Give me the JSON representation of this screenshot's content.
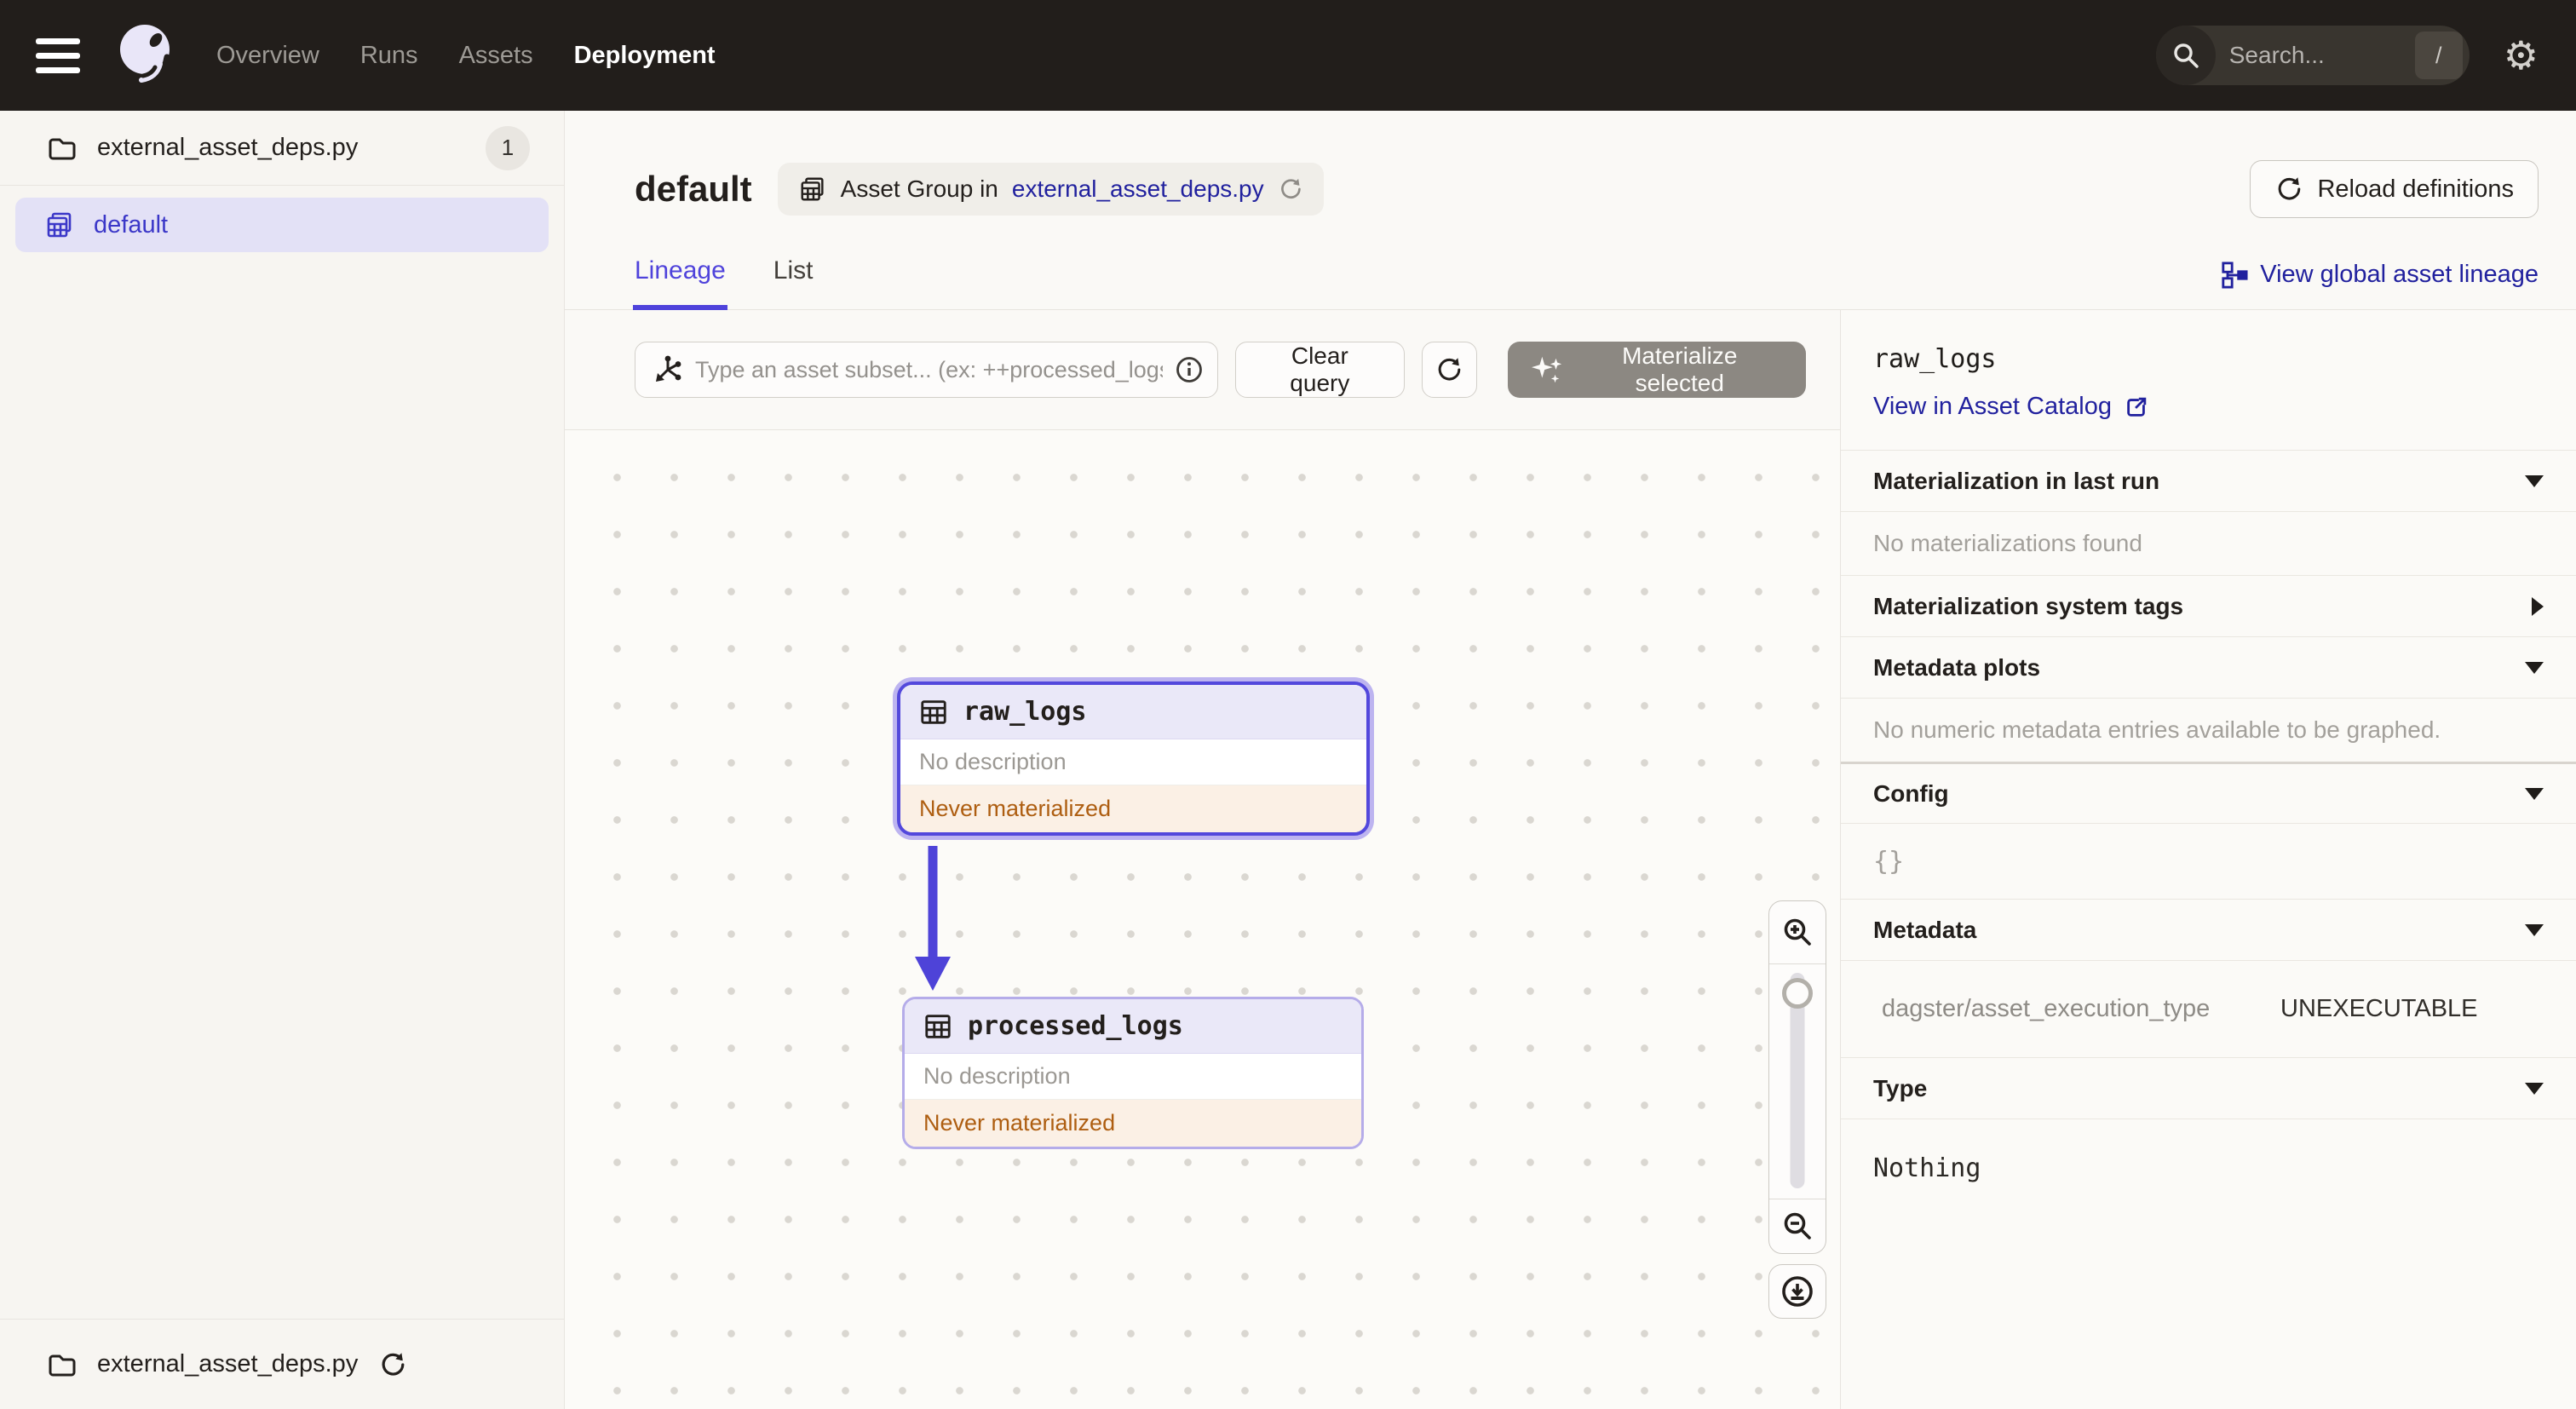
{
  "colors": {
    "accent": "#4F43DB",
    "link_navy": "#21219E",
    "status_warning_text": "#AE5E11",
    "status_warning_bg": "#FBF0E5",
    "nav_bg": "#221E1B"
  },
  "nav": {
    "items": [
      {
        "label": "Overview"
      },
      {
        "label": "Runs"
      },
      {
        "label": "Assets"
      },
      {
        "label": "Deployment"
      }
    ],
    "search": {
      "placeholder": "Search...",
      "shortcut": "/"
    }
  },
  "sidebar": {
    "file": {
      "label": "external_asset_deps.py",
      "count": "1"
    },
    "selected_group": {
      "label": "default"
    },
    "footer": {
      "label": "external_asset_deps.py"
    }
  },
  "header": {
    "title": "default",
    "group_tag": {
      "prefix": "Asset Group in",
      "link_label": "external_asset_deps.py"
    },
    "reload_button_label": "Reload definitions"
  },
  "tabs": [
    {
      "label": "Lineage"
    },
    {
      "label": "List"
    }
  ],
  "lineage_link_label": "View global asset lineage",
  "toolbar": {
    "query_placeholder": "Type an asset subset... (ex: ++processed_logs)",
    "clear_label": "Clear query",
    "materialize_label": "Materialize selected"
  },
  "graph": {
    "nodes": [
      {
        "name": "raw_logs",
        "description": "No description",
        "status": "Never materialized"
      },
      {
        "name": "processed_logs",
        "description": "No description",
        "status": "Never materialized"
      }
    ]
  },
  "panel": {
    "title": "raw_logs",
    "catalog_link_label": "View in Asset Catalog",
    "last_run": {
      "label": "Materialization in last run",
      "empty_text": "No materializations found"
    },
    "system_tags": {
      "label": "Materialization system tags"
    },
    "metadata_plots": {
      "label": "Metadata plots",
      "empty_text": "No numeric metadata entries available to be graphed."
    },
    "config": {
      "label": "Config",
      "value": "{}"
    },
    "metadata": {
      "label": "Metadata",
      "entry": {
        "key": "dagster/asset_execution_type",
        "value": "UNEXECUTABLE"
      }
    },
    "type": {
      "label": "Type",
      "value": "Nothing"
    }
  }
}
